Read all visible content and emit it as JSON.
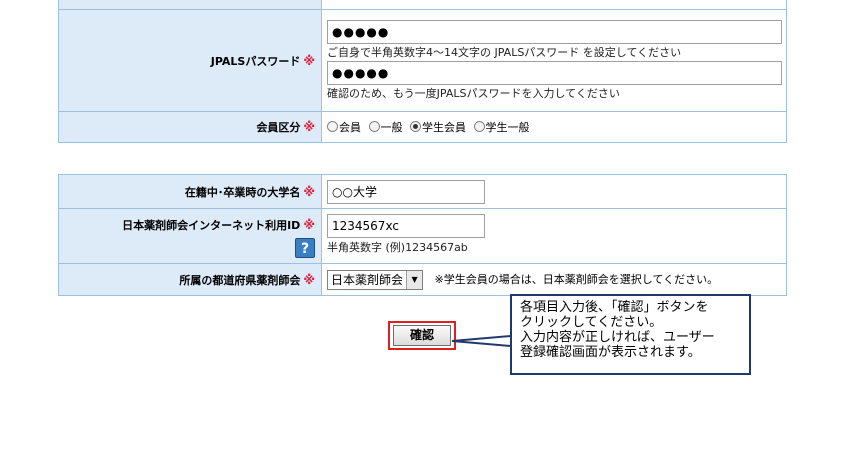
{
  "form1": {
    "password": {
      "label": "JPALSパスワード",
      "required_mark": "※",
      "value": "●●●●●",
      "hint": "ご自身で半角英数字4〜14文字の JPALSパスワード を設定してください",
      "confirm_value": "●●●●●",
      "confirm_hint": "確認のため、もう一度JPALSパスワードを入力してください"
    },
    "member_type": {
      "label": "会員区分",
      "required_mark": "※",
      "options": [
        "会員",
        "一般",
        "学生会員",
        "学生一般"
      ],
      "selected": "学生会員"
    }
  },
  "form2": {
    "university": {
      "label": "在籍中･卒業時の大学名",
      "required_mark": "※",
      "value": "○○大学"
    },
    "internet_id": {
      "label": "日本薬剤師会インターネット利用ID",
      "required_mark": "※",
      "value": "1234567xc",
      "help_icon": "?",
      "hint": "半角英数字 (例)1234567ab"
    },
    "association": {
      "label": "所属の都道府県薬剤師会",
      "required_mark": "※",
      "selected": "日本薬剤師会",
      "note": "※学生会員の場合は、日本薬剤師会を選択してください。"
    }
  },
  "confirm_button": {
    "label": "確認"
  },
  "callout": {
    "lines": [
      "各項目入力後、「確認」ボタンを",
      "クリックしてください。",
      "入力内容が正しければ、ユーザー",
      "登録確認画面が表示されます。"
    ]
  }
}
